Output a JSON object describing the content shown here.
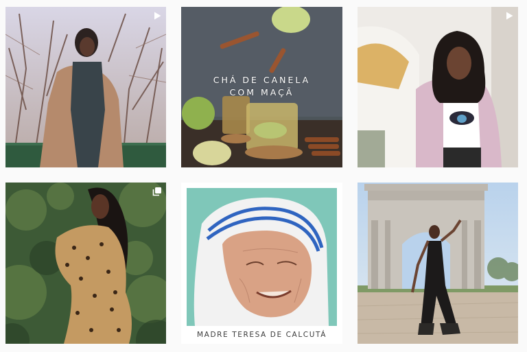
{
  "feed": {
    "posts": [
      {
        "type": "video",
        "badge_icon": "play-icon"
      },
      {
        "type": "image",
        "overlay_line1": "CHÁ DE CANELA",
        "overlay_line2": "COM MAÇÃ"
      },
      {
        "type": "video",
        "badge_icon": "play-icon"
      },
      {
        "type": "carousel",
        "badge_icon": "carousel-icon"
      },
      {
        "type": "image",
        "caption": "MADRE TERESA DE CALCUTÁ"
      },
      {
        "type": "image"
      }
    ]
  },
  "colors": {
    "background": "#fafafa",
    "badge": "#ffffff",
    "caption_text": "#3a3a3a"
  }
}
